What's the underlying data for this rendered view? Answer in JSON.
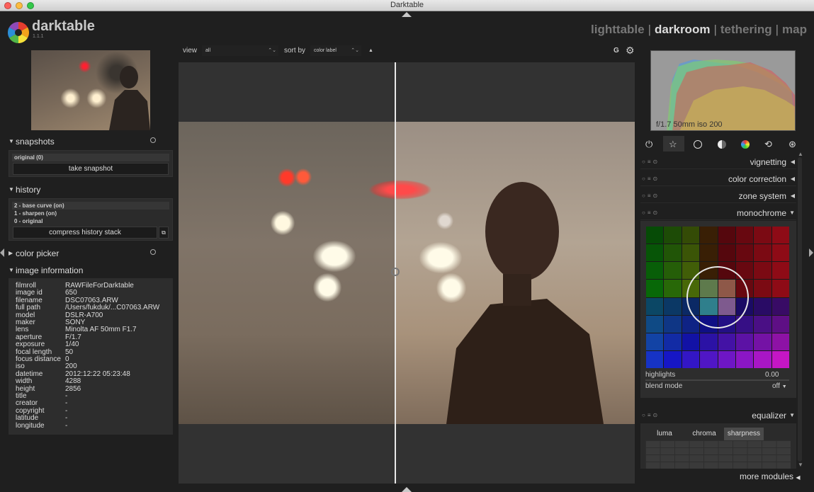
{
  "window": {
    "title": "Darktable"
  },
  "app": {
    "name": "darktable",
    "version": "1.1.1"
  },
  "views": [
    {
      "label": "lighttable",
      "active": false
    },
    {
      "label": "darkroom",
      "active": true
    },
    {
      "label": "tethering",
      "active": false
    },
    {
      "label": "map",
      "active": false
    }
  ],
  "toolbar": {
    "view_label": "view",
    "view_value": "all",
    "sort_label": "sort by",
    "sort_value": "color label",
    "sort_dir": "▲",
    "grouping": "G"
  },
  "snapshots": {
    "title": "snapshots",
    "items": [
      "original (0)"
    ],
    "take_button": "take snapshot"
  },
  "history": {
    "title": "history",
    "items": [
      "2 - base curve (on)",
      "1 - sharpen (on)",
      "0 - original"
    ],
    "compress_button": "compress history stack"
  },
  "color_picker": {
    "title": "color picker"
  },
  "image_information": {
    "title": "image information",
    "rows": [
      {
        "k": "filmroll",
        "v": "RAWFileForDarktable"
      },
      {
        "k": "image id",
        "v": "650"
      },
      {
        "k": "filename",
        "v": "DSC07063.ARW"
      },
      {
        "k": "full path",
        "v": "/Users/fukduk/...C07063.ARW"
      },
      {
        "k": "model",
        "v": "DSLR-A700"
      },
      {
        "k": "maker",
        "v": "SONY"
      },
      {
        "k": "lens",
        "v": "Minolta AF 50mm F1.7"
      },
      {
        "k": "aperture",
        "v": "F/1.7"
      },
      {
        "k": "exposure",
        "v": "1/40"
      },
      {
        "k": "focal length",
        "v": "50"
      },
      {
        "k": "focus distance",
        "v": "0"
      },
      {
        "k": "iso",
        "v": "200"
      },
      {
        "k": "datetime",
        "v": "2012:12:22 05:23:48"
      },
      {
        "k": "width",
        "v": "4288"
      },
      {
        "k": "height",
        "v": "2856"
      },
      {
        "k": "title",
        "v": "-"
      },
      {
        "k": "creator",
        "v": "-"
      },
      {
        "k": "copyright",
        "v": "-"
      },
      {
        "k": "latitude",
        "v": "-"
      },
      {
        "k": "longitude",
        "v": "-"
      }
    ]
  },
  "histogram": {
    "exif": "f/1.7 50mm iso 200"
  },
  "modules": [
    {
      "name": "vignetting",
      "expanded": false
    },
    {
      "name": "color correction",
      "expanded": false
    },
    {
      "name": "zone system",
      "expanded": false
    },
    {
      "name": "monochrome",
      "expanded": true
    }
  ],
  "monochrome": {
    "highlights_label": "highlights",
    "highlights_value": "0.00",
    "blend_label": "blend mode",
    "blend_value": "off"
  },
  "equalizer": {
    "name": "equalizer",
    "tabs": [
      "luma",
      "chroma",
      "sharpness"
    ],
    "active_tab": "sharpness"
  },
  "more_modules": "more modules"
}
